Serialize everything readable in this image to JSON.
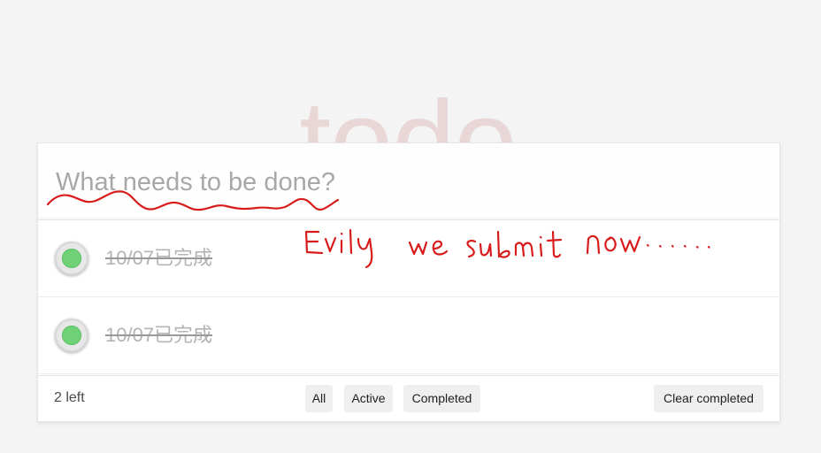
{
  "app": {
    "title": "todo"
  },
  "input": {
    "placeholder": "What needs to be done?",
    "value": ""
  },
  "todos": [
    {
      "label": "10/07已完成",
      "completed": true
    },
    {
      "label": "10/07已完成",
      "completed": true
    }
  ],
  "footer": {
    "count_text": "2 left",
    "filters": [
      "All",
      "Active",
      "Completed"
    ],
    "clear_label": "Clear completed"
  },
  "annotation": {
    "handwritten_text": "Evily we submit now......",
    "color": "#d81c1c"
  },
  "colors": {
    "toggle_green": "#6fd276",
    "title_color": "rgba(175, 47, 47, 0.15)"
  }
}
